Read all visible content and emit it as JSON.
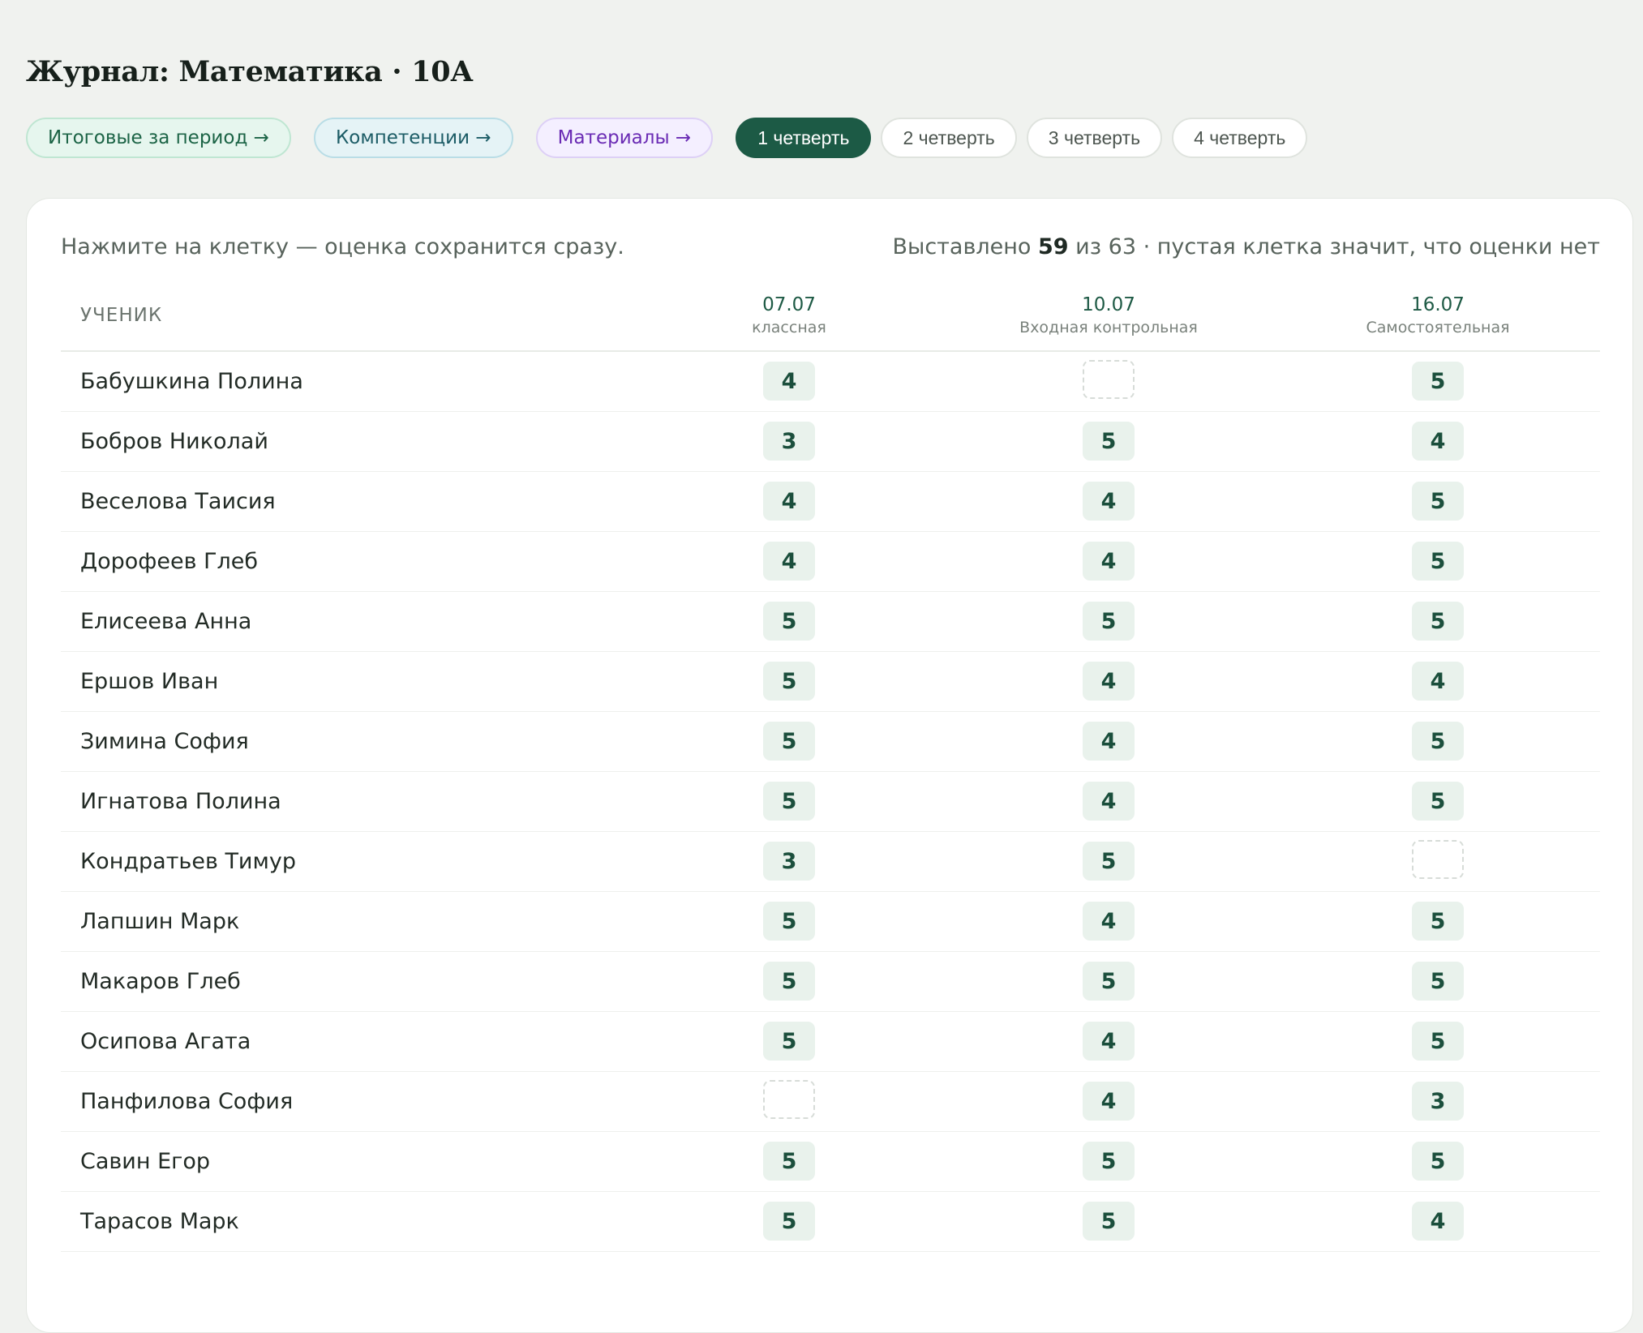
{
  "page": {
    "title": "Журнал: Математика · 10А"
  },
  "nav": {
    "links": [
      {
        "label": "Итоговые за период →"
      },
      {
        "label": "Компетенции →"
      },
      {
        "label": "Материалы →"
      }
    ],
    "quarters": [
      {
        "label": "1 четверть",
        "active": true
      },
      {
        "label": "2 четверть",
        "active": false
      },
      {
        "label": "3 четверть",
        "active": false
      },
      {
        "label": "4 четверть",
        "active": false
      }
    ]
  },
  "journal": {
    "hint": "Нажмите на клетку — оценка сохранится сразу.",
    "summary": {
      "prefix": "Выставлено",
      "filled": "59",
      "middle": "из 63 · пустая клетка значит, что оценки нет"
    },
    "columns": {
      "student_header": "УЧЕНИК",
      "lessons": [
        {
          "date": "07.07",
          "type": "классная"
        },
        {
          "date": "10.07",
          "type": "Входная контрольная"
        },
        {
          "date": "16.07",
          "type": "Самостоятельная"
        }
      ]
    },
    "rows": [
      {
        "name": "Бабушкина Полина",
        "grades": [
          "4",
          "",
          "5"
        ]
      },
      {
        "name": "Бобров Николай",
        "grades": [
          "3",
          "5",
          "4"
        ]
      },
      {
        "name": "Веселова Таисия",
        "grades": [
          "4",
          "4",
          "5"
        ]
      },
      {
        "name": "Дорофеев Глеб",
        "grades": [
          "4",
          "4",
          "5"
        ]
      },
      {
        "name": "Елисеева Анна",
        "grades": [
          "5",
          "5",
          "5"
        ]
      },
      {
        "name": "Ершов Иван",
        "grades": [
          "5",
          "4",
          "4"
        ]
      },
      {
        "name": "Зимина София",
        "grades": [
          "5",
          "4",
          "5"
        ]
      },
      {
        "name": "Игнатова Полина",
        "grades": [
          "5",
          "4",
          "5"
        ]
      },
      {
        "name": "Кондратьев Тимур",
        "grades": [
          "3",
          "5",
          ""
        ]
      },
      {
        "name": "Лапшин Марк",
        "grades": [
          "5",
          "4",
          "5"
        ]
      },
      {
        "name": "Макаров Глеб",
        "grades": [
          "5",
          "5",
          "5"
        ]
      },
      {
        "name": "Осипова Агата",
        "grades": [
          "5",
          "4",
          "5"
        ]
      },
      {
        "name": "Панфилова София",
        "grades": [
          "",
          "4",
          "3"
        ]
      },
      {
        "name": "Савин Егор",
        "grades": [
          "5",
          "5",
          "5"
        ]
      },
      {
        "name": "Тарасов Марк",
        "grades": [
          "5",
          "5",
          "4"
        ]
      }
    ]
  }
}
